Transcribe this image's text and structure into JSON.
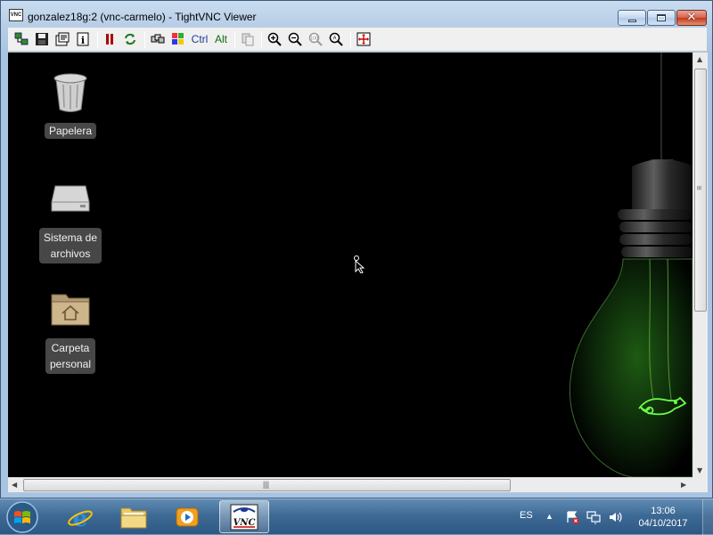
{
  "window": {
    "title": "gonzalez18g:2 (vnc-carmelo) - TightVNC Viewer",
    "icon_text": "VNC",
    "controls": {
      "minimize": "minimize",
      "maximize": "maximize",
      "close": "close"
    }
  },
  "toolbar": {
    "items": [
      {
        "name": "new-connection-icon"
      },
      {
        "name": "save-icon"
      },
      {
        "name": "options-icon"
      },
      {
        "name": "connection-info-icon"
      },
      {
        "name": "pause-icon"
      },
      {
        "name": "refresh-icon"
      },
      {
        "name": "ctrl-alt-del-icon"
      },
      {
        "name": "ctrl-esc-icon"
      },
      {
        "name": "zoom-in-icon"
      },
      {
        "name": "zoom-out-icon"
      },
      {
        "name": "zoom-100-icon"
      },
      {
        "name": "zoom-auto-icon"
      },
      {
        "name": "fullscreen-icon"
      }
    ],
    "ctrl_label": "Ctrl",
    "alt_label": "Alt"
  },
  "desktop": {
    "icons": [
      {
        "name": "trash",
        "label_lines": [
          "Papelera"
        ]
      },
      {
        "name": "filesystem",
        "label_lines": [
          "Sistema de",
          "archivos"
        ]
      },
      {
        "name": "home-folder",
        "label_lines": [
          "Carpeta",
          "personal"
        ]
      }
    ],
    "wallpaper": "openSUSE lightbulb",
    "accent_color": "#4fd13a"
  },
  "taskbar": {
    "pinned": [
      {
        "name": "internet-explorer-icon"
      },
      {
        "name": "file-explorer-icon"
      },
      {
        "name": "media-player-icon"
      },
      {
        "name": "tightvnc-icon",
        "active": true
      }
    ],
    "language": "ES",
    "clock": {
      "time": "13:06",
      "date": "04/10/2017"
    }
  },
  "colors": {
    "taskbar": "#3e6a96",
    "window_frame": "#b6cde6",
    "close_button": "#c2391c"
  }
}
